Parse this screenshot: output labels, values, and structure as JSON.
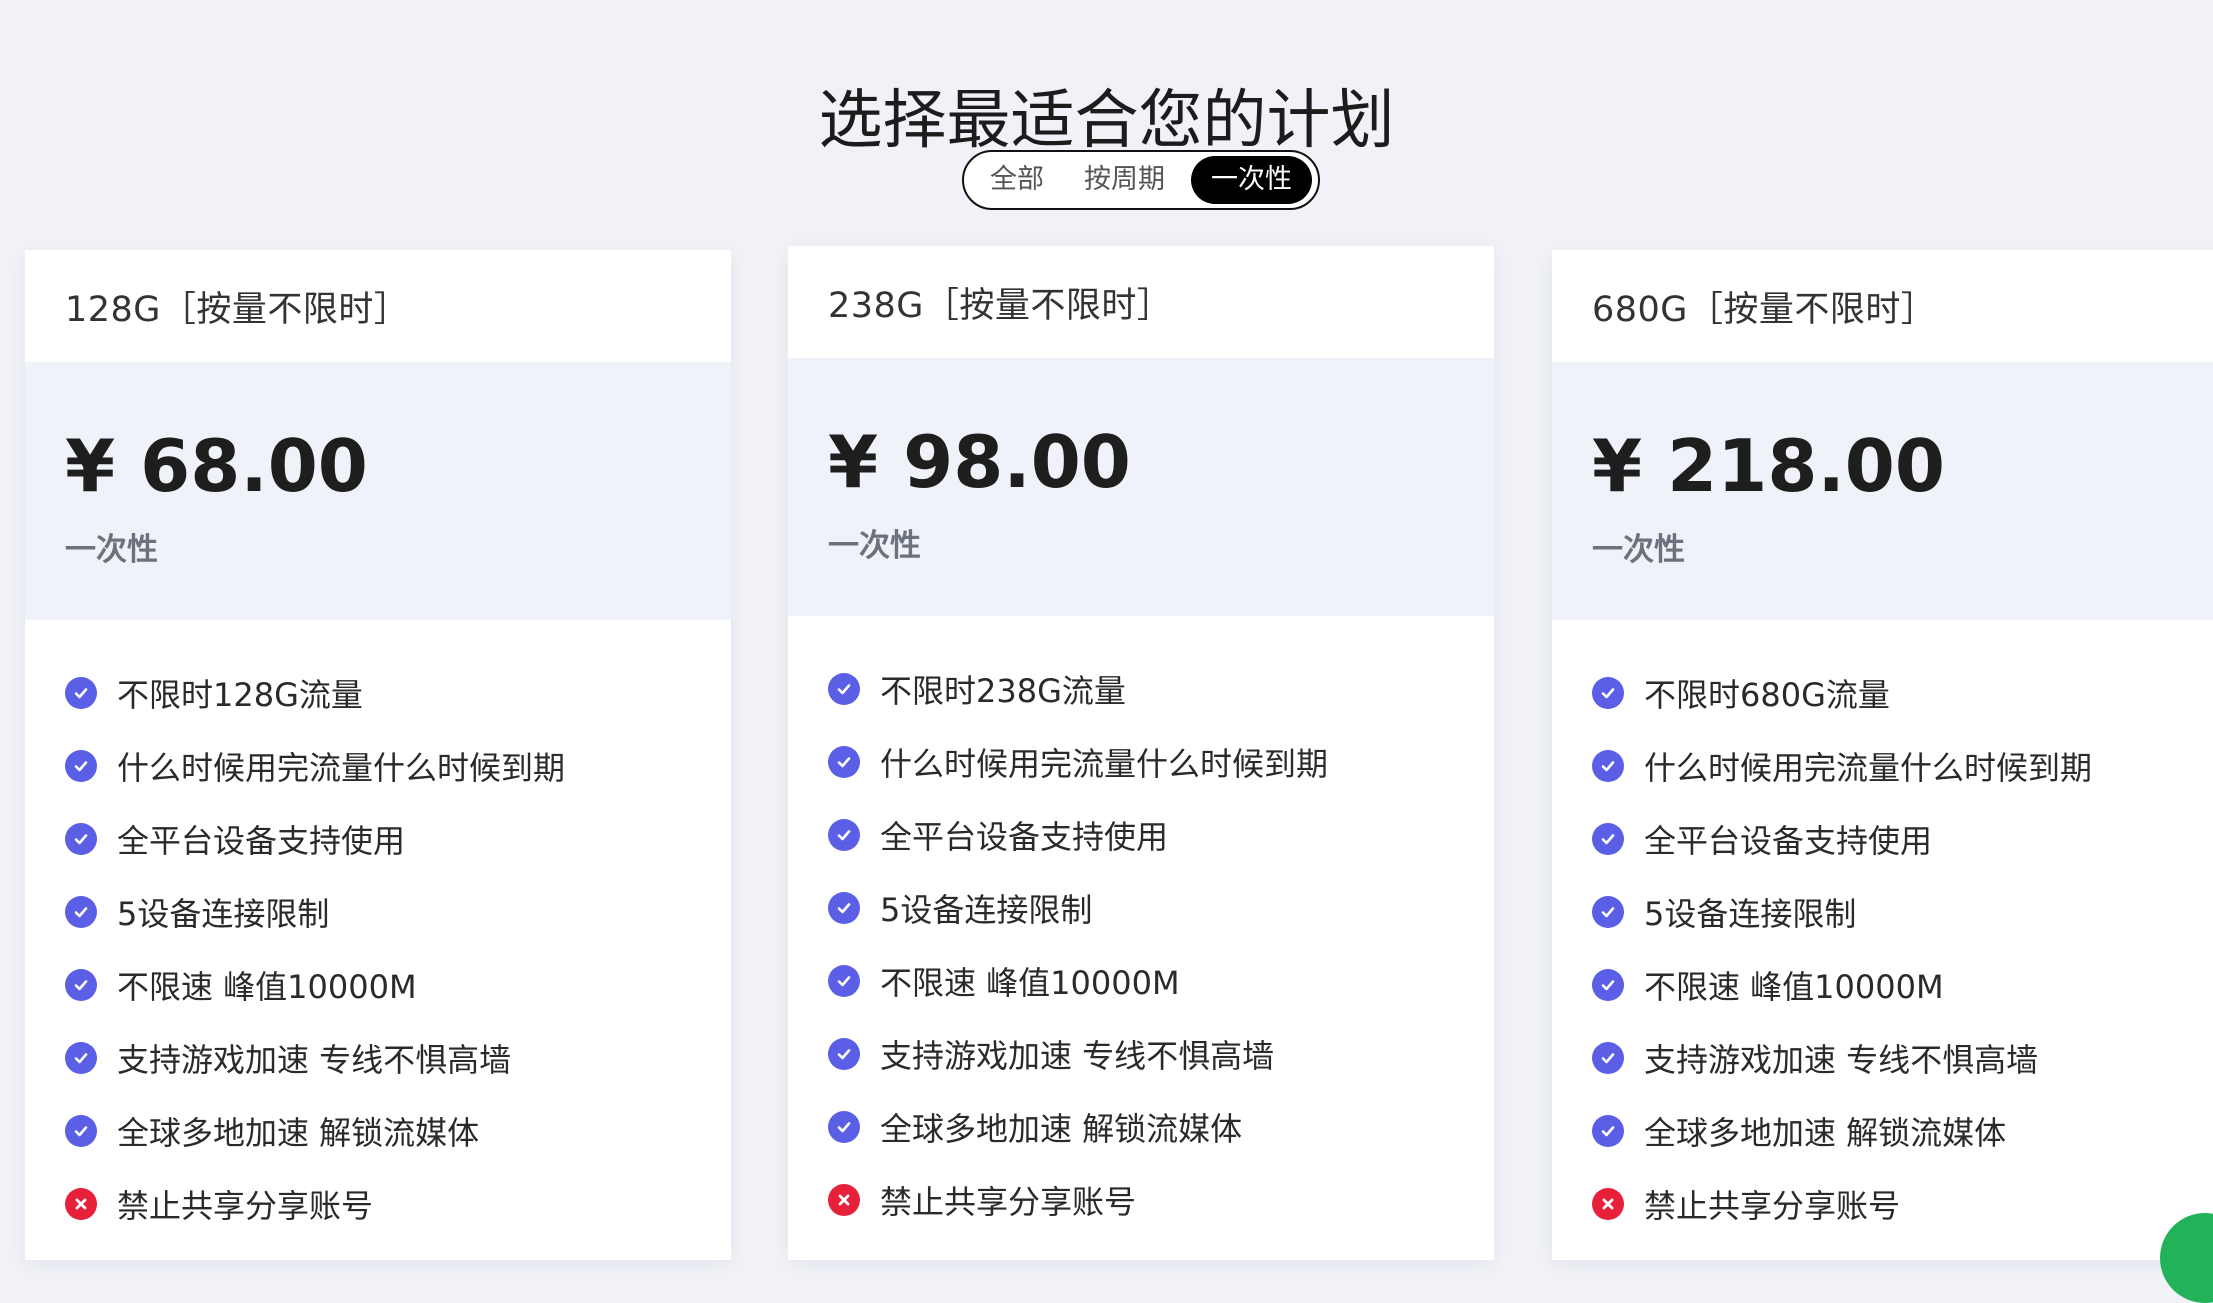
{
  "page": {
    "title": "选择最适合您的计划"
  },
  "filter": {
    "options": [
      {
        "label": "全部",
        "active": false
      },
      {
        "label": "按周期",
        "active": false
      },
      {
        "label": "一次性",
        "active": true
      }
    ]
  },
  "plans": [
    {
      "name": "128G［按量不限时］",
      "price": "¥ 68.00",
      "cycle": "一次性",
      "features": [
        {
          "text": "不限时128G流量",
          "included": true
        },
        {
          "text": "什么时候用完流量什么时候到期",
          "included": true
        },
        {
          "text": "全平台设备支持使用",
          "included": true
        },
        {
          "text": "5设备连接限制",
          "included": true
        },
        {
          "text": "不限速 峰值10000M",
          "included": true
        },
        {
          "text": "支持游戏加速 专线不惧高墙",
          "included": true
        },
        {
          "text": "全球多地加速 解锁流媒体",
          "included": true
        },
        {
          "text": "禁止共享分享账号",
          "included": false
        }
      ]
    },
    {
      "name": "238G［按量不限时］",
      "price": "¥ 98.00",
      "cycle": "一次性",
      "features": [
        {
          "text": "不限时238G流量",
          "included": true
        },
        {
          "text": "什么时候用完流量什么时候到期",
          "included": true
        },
        {
          "text": "全平台设备支持使用",
          "included": true
        },
        {
          "text": "5设备连接限制",
          "included": true
        },
        {
          "text": "不限速 峰值10000M",
          "included": true
        },
        {
          "text": "支持游戏加速 专线不惧高墙",
          "included": true
        },
        {
          "text": "全球多地加速 解锁流媒体",
          "included": true
        },
        {
          "text": "禁止共享分享账号",
          "included": false
        }
      ]
    },
    {
      "name": "680G［按量不限时］",
      "price": "¥ 218.00",
      "cycle": "一次性",
      "features": [
        {
          "text": "不限时680G流量",
          "included": true
        },
        {
          "text": "什么时候用完流量什么时候到期",
          "included": true
        },
        {
          "text": "全平台设备支持使用",
          "included": true
        },
        {
          "text": "5设备连接限制",
          "included": true
        },
        {
          "text": "不限速 峰值10000M",
          "included": true
        },
        {
          "text": "支持游戏加速 专线不惧高墙",
          "included": true
        },
        {
          "text": "全球多地加速 解锁流媒体",
          "included": true
        },
        {
          "text": "禁止共享分享账号",
          "included": false
        }
      ]
    }
  ],
  "icons": {
    "included": "check-circle-icon",
    "excluded": "x-circle-icon",
    "corner": "chat-bubble-icon"
  },
  "colors": {
    "background": "#f0f2f7",
    "price_panel": "#eff2f8",
    "check": "#5b5fe6",
    "cross": "#e8213a",
    "toggle_active": "#000000",
    "corner_badge": "#22b35a"
  }
}
